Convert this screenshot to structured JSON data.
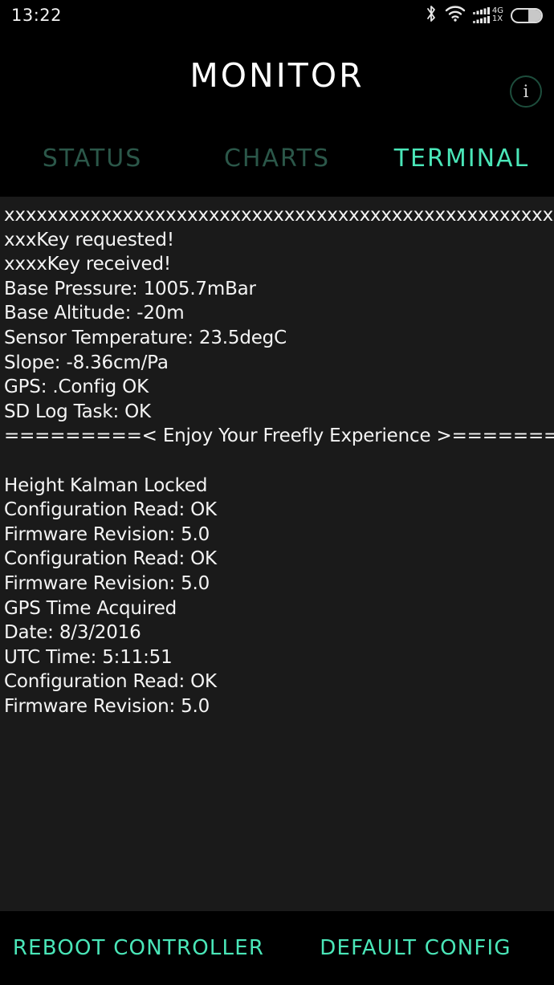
{
  "status_bar": {
    "clock": "13:22",
    "network_label_top": "4G",
    "network_label_bottom": "1X",
    "icons": [
      "bluetooth-icon",
      "wifi-icon",
      "cellular-signal-icon",
      "battery-icon"
    ],
    "battery_level_percent": 45
  },
  "header": {
    "title": "MONITOR",
    "info_label": "i"
  },
  "tabs": [
    {
      "label": "STATUS",
      "active": false
    },
    {
      "label": "CHARTS",
      "active": false
    },
    {
      "label": "TERMINAL",
      "active": true
    }
  ],
  "terminal": {
    "lines": [
      "xxxxxxxxxxxxxxxxxxxxxxxxxxxxxxxxxxxxxxxxxxxxxxxxxxxx",
      "xxxKey requested!",
      "xxxxKey received!",
      "Base Pressure: 1005.7mBar",
      "Base Altitude: -20m",
      "Sensor Temperature: 23.5degC",
      "Slope: -8.36cm/Pa",
      "GPS: .Config OK",
      "SD Log Task: OK",
      "=========< Enjoy Your Freefly Experience >=========",
      "",
      "Height Kalman Locked",
      "Configuration Read: OK",
      "Firmware Revision: 5.0",
      "Configuration Read: OK",
      "Firmware Revision: 5.0",
      "GPS Time Acquired",
      "Date: 8/3/2016",
      "UTC Time: 5:11:51",
      "Configuration Read: OK",
      "Firmware Revision: 5.0"
    ]
  },
  "actions": [
    {
      "label": "REBOOT CONTROLLER"
    },
    {
      "label": "DEFAULT CONFIG"
    }
  ],
  "colors": {
    "accent": "#4ae6b8",
    "tab_inactive": "#2b5749",
    "terminal_bg": "#1a1a1a",
    "terminal_text": "#f4f4f4",
    "page_bg": "#000000"
  }
}
